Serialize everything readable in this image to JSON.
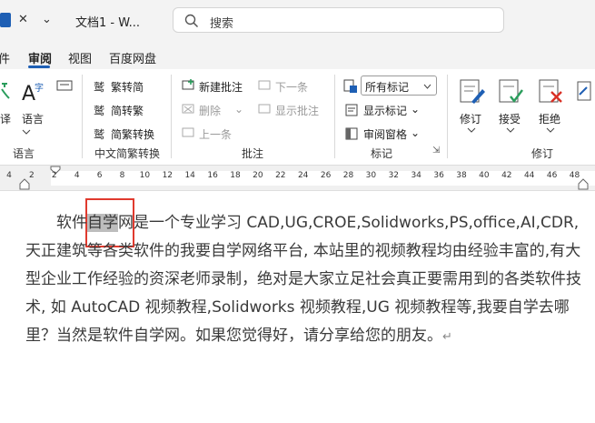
{
  "titlebar": {
    "doc_tab_title": "文档1 - W...",
    "search_placeholder": "搜索",
    "close_glyph": "✕",
    "dropdown_glyph": "⌄"
  },
  "tabs": [
    {
      "label": "件",
      "active": false
    },
    {
      "label": "审阅",
      "active": true
    },
    {
      "label": "视图",
      "active": false
    },
    {
      "label": "百度网盘",
      "active": false
    }
  ],
  "ribbon": {
    "language": {
      "btn": "语言",
      "group_label": "语言"
    },
    "chinese_conversion": {
      "trad_to_simp": "繁转简",
      "simp_to_trad": "简转繁",
      "conversion": "简繁转换",
      "group_label": "中文简繁转换"
    },
    "comments": {
      "new": "新建批注",
      "next": "下一条",
      "delete": "删除",
      "show": "显示批注",
      "prev": "上一条",
      "group_label": "批注"
    },
    "tracking": {
      "markup_select": "所有标记",
      "show_markup": "显示标记",
      "reviewing_pane": "审阅窗格",
      "group_label": "标记"
    },
    "changes": {
      "track": "修订",
      "accept": "接受",
      "reject": "拒绝",
      "group_label": "修订"
    }
  },
  "ruler": {
    "numbers": [
      "4",
      "2",
      "2",
      "4",
      "6",
      "8",
      "10",
      "12",
      "14",
      "16",
      "18",
      "20",
      "22",
      "24",
      "26",
      "28",
      "30",
      "32",
      "34",
      "36",
      "38",
      "40",
      "42",
      "44",
      "46",
      "48"
    ]
  },
  "document": {
    "indent": "　　",
    "before_selection": "软件",
    "selection": "自学",
    "after_selection": "网是一个专业学习 CAD,UG,CROE,Solidworks,PS,office,AI,CDR,天正建筑等各类软件的我要自学网络平台, 本站里的视频教程均由经验丰富的,有大型企业工作经验的资深老师录制，绝对是大家立足社会真正要需用到的各类软件技术, 如 AutoCAD 视频教程,Solidworks 视频教程,UG 视频教程等,我要自学去哪里？当然是软件自学网。如果您觉得好，请分享给您的朋友。",
    "paragraph_mark": "↵"
  },
  "colors": {
    "accent": "#1e5fb4",
    "selection": "#bdbdbd",
    "highlight_box": "#e03a2e"
  }
}
